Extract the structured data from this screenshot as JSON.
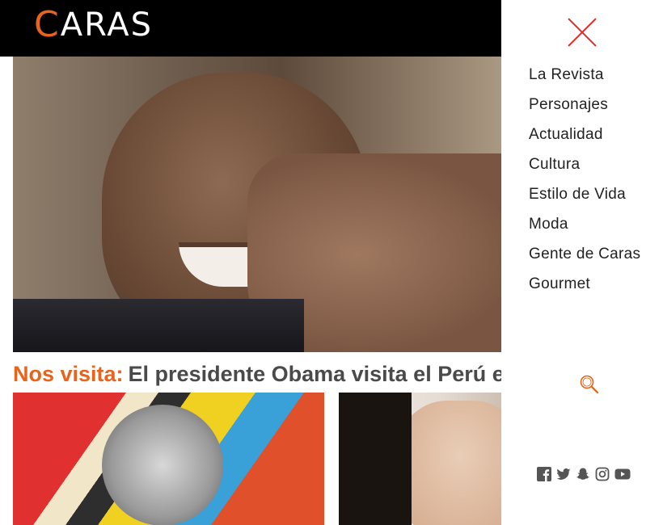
{
  "header": {
    "logo_initial": "C",
    "logo_rest": "ARAS",
    "brand_color": "#e8641c",
    "bar_color": "#000000"
  },
  "hero": {
    "kicker": "Nos visita:",
    "title": "El presidente Obama visita el Perú en el m"
  },
  "menu": {
    "close_icon": "close-icon",
    "accent_color": "#e32b2b",
    "items": [
      {
        "label": "La Revista"
      },
      {
        "label": "Personajes"
      },
      {
        "label": "Actualidad"
      },
      {
        "label": "Cultura"
      },
      {
        "label": "Estilo de Vida"
      },
      {
        "label": "Moda"
      },
      {
        "label": "Gente de Caras"
      },
      {
        "label": "Gourmet"
      }
    ],
    "search_icon": "search-icon",
    "social": [
      "facebook-icon",
      "twitter-icon",
      "snapchat-icon",
      "instagram-icon",
      "youtube-icon"
    ]
  }
}
